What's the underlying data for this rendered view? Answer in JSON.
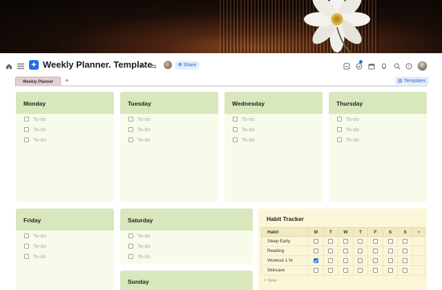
{
  "document": {
    "title": "Weekly Planner. Template",
    "share_label": "Share"
  },
  "tabs": [
    {
      "label": "Weekly Planner",
      "active": true
    }
  ],
  "templates_label": "Templates",
  "todo_placeholder": "To-do",
  "days": [
    {
      "name": "Monday",
      "todos": [
        "To-do",
        "To-do",
        "To-do"
      ]
    },
    {
      "name": "Tuesday",
      "todos": [
        "To-do",
        "To-do",
        "To-do"
      ]
    },
    {
      "name": "Wednesday",
      "todos": [
        "To-do",
        "To-do",
        "To-do"
      ]
    },
    {
      "name": "Thursday",
      "todos": [
        "To-do",
        "To-do",
        "To-do"
      ]
    },
    {
      "name": "Friday",
      "todos": [
        "To-do",
        "To-do",
        "To-do"
      ]
    },
    {
      "name": "Saturday",
      "todos": [
        "To-do",
        "To-do",
        "To-do"
      ]
    },
    {
      "name": "Sunday",
      "todos": []
    }
  ],
  "habit_tracker": {
    "title": "Habit Tracker",
    "columns": [
      "Habit",
      "M",
      "T",
      "W",
      "T",
      "F",
      "S",
      "S"
    ],
    "rows": [
      {
        "habit": "Sleep Early",
        "checks": [
          false,
          false,
          false,
          false,
          false,
          false,
          false
        ]
      },
      {
        "habit": "Reading",
        "checks": [
          false,
          false,
          false,
          false,
          false,
          false,
          false
        ]
      },
      {
        "habit": "Workout 1 hr",
        "checks": [
          true,
          false,
          false,
          false,
          false,
          false,
          false
        ]
      },
      {
        "habit": "Skincare",
        "checks": [
          false,
          false,
          false,
          false,
          false,
          false,
          false
        ]
      }
    ],
    "new_label": "New"
  },
  "colors": {
    "day_header": "#d8e7bc",
    "day_body": "#f7fbe9",
    "habit_body": "#fbf6d8",
    "accent": "#1f6feb"
  },
  "icons": {
    "toolbar_left": [
      "home-icon",
      "menu-icon"
    ],
    "toolbar_right": [
      "save-icon",
      "check-circle-icon",
      "calendar-icon",
      "bell-icon",
      "search-icon",
      "help-icon"
    ]
  }
}
